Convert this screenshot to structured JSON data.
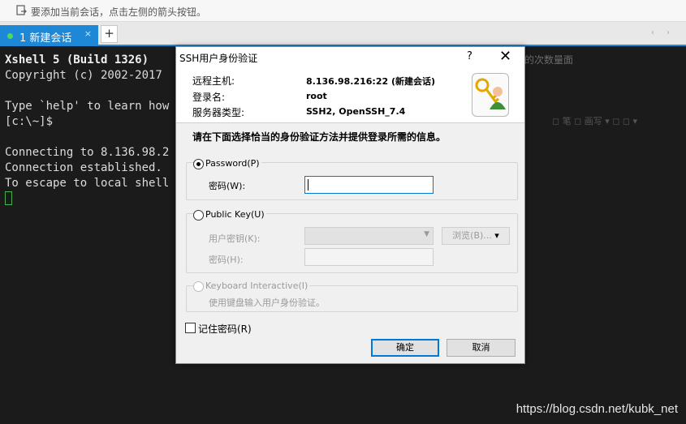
{
  "hint_bar": {
    "text": "要添加当前会话，点击左侧的箭头按钮。"
  },
  "tabs": {
    "active_label": "1 新建会话",
    "close_glyph": "×",
    "add_glyph": "+",
    "nav_glyphs": "‹ ›"
  },
  "terminal": {
    "lines": [
      "Xshell 5 (Build 1326)",
      "Copyright (c) 2002-2017",
      "",
      "Type `help' to learn how",
      "[c:\\~]$",
      "",
      "Connecting to 8.136.98.2",
      "Connection established.",
      "To escape to local shell"
    ],
    "watermark": "https://blog.csdn.net/kubk_net"
  },
  "background_right": {
    "text": "的次数量面",
    "toolbar": "◻ 笔  ◻ 画写  ▾   ◻ ◻  ▾"
  },
  "dialog": {
    "title": "SSH用户身份验证",
    "help_glyph": "?",
    "close_glyph": "✕",
    "info": {
      "remote_host_label": "远程主机:",
      "remote_host_value": "8.136.98.216:22 (新建会话)",
      "login_label": "登录名:",
      "login_value": "root",
      "server_type_label": "服务器类型:",
      "server_type_value": "SSH2, OpenSSH_7.4"
    },
    "instruction": "请在下面选择恰当的身份验证方法并提供登录所需的信息。",
    "password_group": {
      "radio_label": "Password(P)",
      "checked": true,
      "field_label": "密码(W):",
      "field_value": ""
    },
    "publickey_group": {
      "radio_label": "Public Key(U)",
      "checked": false,
      "user_key_label": "用户密钥(K):",
      "user_key_value": "",
      "browse_label": "浏览(B)...",
      "browse_arrow": "▾",
      "password_label": "密码(H):",
      "password_value": ""
    },
    "keyboard_group": {
      "radio_label": "Keyboard Interactive(I)",
      "checked": false,
      "description": "使用键盘输入用户身份验证。"
    },
    "remember_password": {
      "label": "记住密码(R)",
      "checked": false
    },
    "ok_label": "确定",
    "cancel_label": "取消"
  },
  "colors": {
    "tab_active": "#1e88d6",
    "terminal_bg": "#1b1b1b",
    "focus_blue": "#0078d7",
    "cursor_green": "#4caf50"
  }
}
